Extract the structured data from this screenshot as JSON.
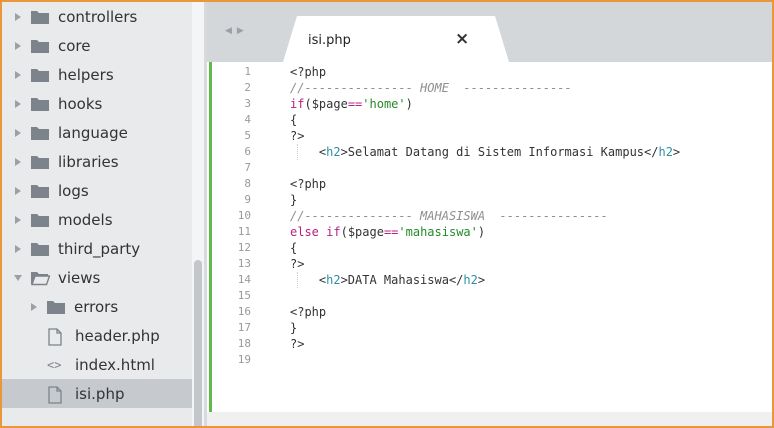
{
  "sidebar": {
    "items": [
      {
        "label": "controllers",
        "type": "folder",
        "expanded": false
      },
      {
        "label": "core",
        "type": "folder",
        "expanded": false
      },
      {
        "label": "helpers",
        "type": "folder",
        "expanded": false
      },
      {
        "label": "hooks",
        "type": "folder",
        "expanded": false
      },
      {
        "label": "language",
        "type": "folder",
        "expanded": false
      },
      {
        "label": "libraries",
        "type": "folder",
        "expanded": false
      },
      {
        "label": "logs",
        "type": "folder",
        "expanded": false
      },
      {
        "label": "models",
        "type": "folder",
        "expanded": false
      },
      {
        "label": "third_party",
        "type": "folder",
        "expanded": false
      },
      {
        "label": "views",
        "type": "folder",
        "expanded": true
      },
      {
        "label": "errors",
        "type": "folder",
        "expanded": false
      },
      {
        "label": "header.php",
        "type": "file",
        "icon": "file-icon"
      },
      {
        "label": "index.html",
        "type": "file",
        "icon": "code-icon",
        "glyph": "<>"
      },
      {
        "label": "isi.php",
        "type": "file",
        "icon": "file-icon",
        "selected": true
      }
    ]
  },
  "tabbar": {
    "nav_back": "◀",
    "nav_forward": "▶",
    "active_tab": {
      "title": "isi.php",
      "close": "×"
    }
  },
  "editor": {
    "line_numbers": [
      "1",
      "2",
      "3",
      "4",
      "5",
      "6",
      "7",
      "8",
      "9",
      "10",
      "11",
      "12",
      "13",
      "14",
      "15",
      "16",
      "17",
      "18",
      "19"
    ],
    "current_line": 19,
    "lines": [
      [
        {
          "t": "php",
          "v": "<?php"
        }
      ],
      [
        {
          "t": "comment",
          "v": "//--------------- HOME  ---------------"
        }
      ],
      [
        {
          "t": "kw",
          "v": "if"
        },
        {
          "t": "text",
          "v": "("
        },
        {
          "t": "var",
          "v": "$page"
        },
        {
          "t": "op",
          "v": "=="
        },
        {
          "t": "str",
          "v": "'home'"
        },
        {
          "t": "text",
          "v": ")"
        }
      ],
      [
        {
          "t": "text",
          "v": "{"
        }
      ],
      [
        {
          "t": "php",
          "v": "?>"
        }
      ],
      [
        {
          "t": "text",
          "v": "    <"
        },
        {
          "t": "tag",
          "v": "h2"
        },
        {
          "t": "text",
          "v": ">Selamat Datang di Sistem Informasi Kampus</"
        },
        {
          "t": "tag",
          "v": "h2"
        },
        {
          "t": "text",
          "v": ">"
        }
      ],
      [],
      [
        {
          "t": "php",
          "v": "<?php"
        }
      ],
      [
        {
          "t": "text",
          "v": "}"
        }
      ],
      [
        {
          "t": "comment",
          "v": "//--------------- MAHASISWA  ---------------"
        }
      ],
      [
        {
          "t": "kw",
          "v": "else if"
        },
        {
          "t": "text",
          "v": "("
        },
        {
          "t": "var",
          "v": "$page"
        },
        {
          "t": "op",
          "v": "=="
        },
        {
          "t": "str",
          "v": "'mahasiswa'"
        },
        {
          "t": "text",
          "v": ")"
        }
      ],
      [
        {
          "t": "text",
          "v": "{"
        }
      ],
      [
        {
          "t": "php",
          "v": "?>"
        }
      ],
      [
        {
          "t": "text",
          "v": "    <"
        },
        {
          "t": "tag",
          "v": "h2"
        },
        {
          "t": "text",
          "v": ">DATA Mahasiswa</"
        },
        {
          "t": "tag",
          "v": "h2"
        },
        {
          "t": "text",
          "v": ">"
        }
      ],
      [],
      [
        {
          "t": "php",
          "v": "<?php"
        }
      ],
      [
        {
          "t": "text",
          "v": "}"
        }
      ],
      [
        {
          "t": "php",
          "v": "?>"
        }
      ],
      []
    ]
  },
  "colors": {
    "frame_border": "#e8973a",
    "sidebar_bg": "#e9eaec",
    "selected_row": "#c6cacf",
    "tabbar_bg": "#d4d7da",
    "gutter_change": "#5fba4a",
    "keyword": "#b81f82",
    "string": "#258a27",
    "tag": "#2e8fa5",
    "comment": "#8e8e8e"
  }
}
